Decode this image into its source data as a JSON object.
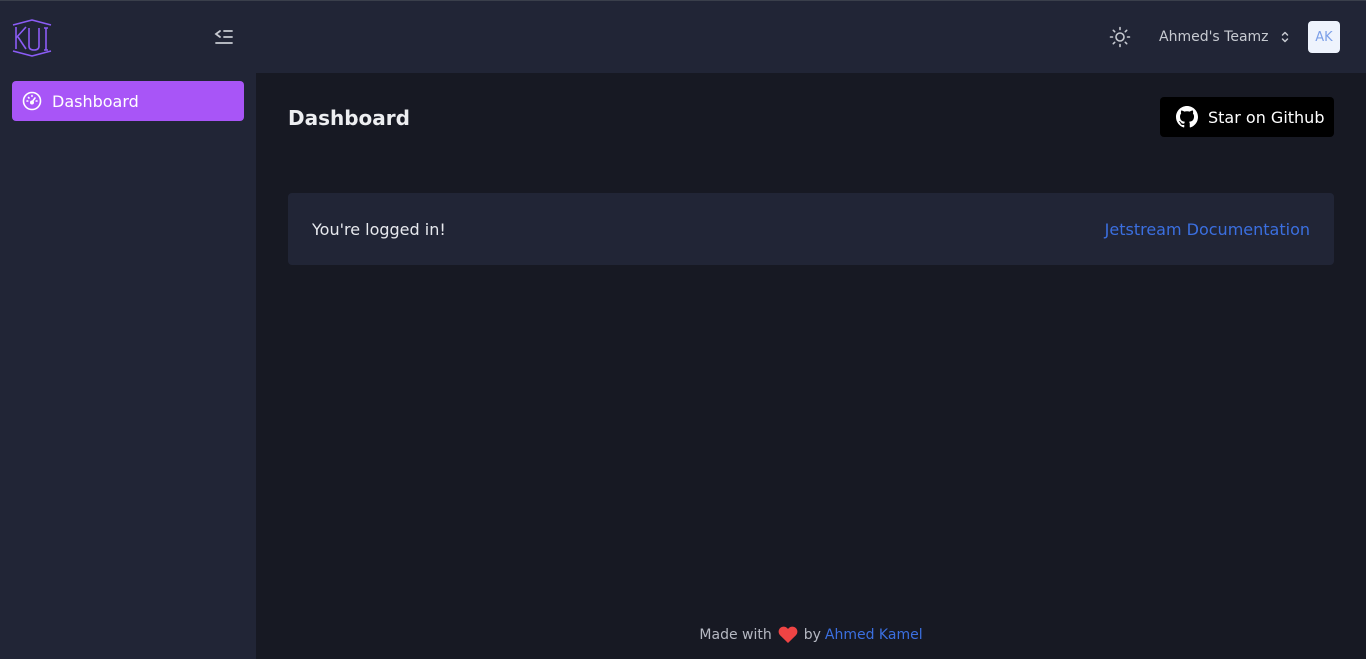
{
  "sidebar": {
    "logo_text": "KUI",
    "items": [
      {
        "label": "Dashboard",
        "icon": "gauge-icon",
        "active": true
      }
    ]
  },
  "topbar": {
    "team_name": "Ahmed's Teamz",
    "avatar_initials": "AK"
  },
  "main": {
    "title": "Dashboard",
    "github_button_label": "Star on Github",
    "card_message": "You're logged in!",
    "card_link": "Jetstream Documentation"
  },
  "footer": {
    "made_with": "Made with",
    "by": "by",
    "author": "Ahmed Kamel"
  },
  "colors": {
    "accent": "#a855f7",
    "link": "#3b6fe0",
    "background": "#171923",
    "panel": "#212536",
    "heart": "#ef4444"
  }
}
